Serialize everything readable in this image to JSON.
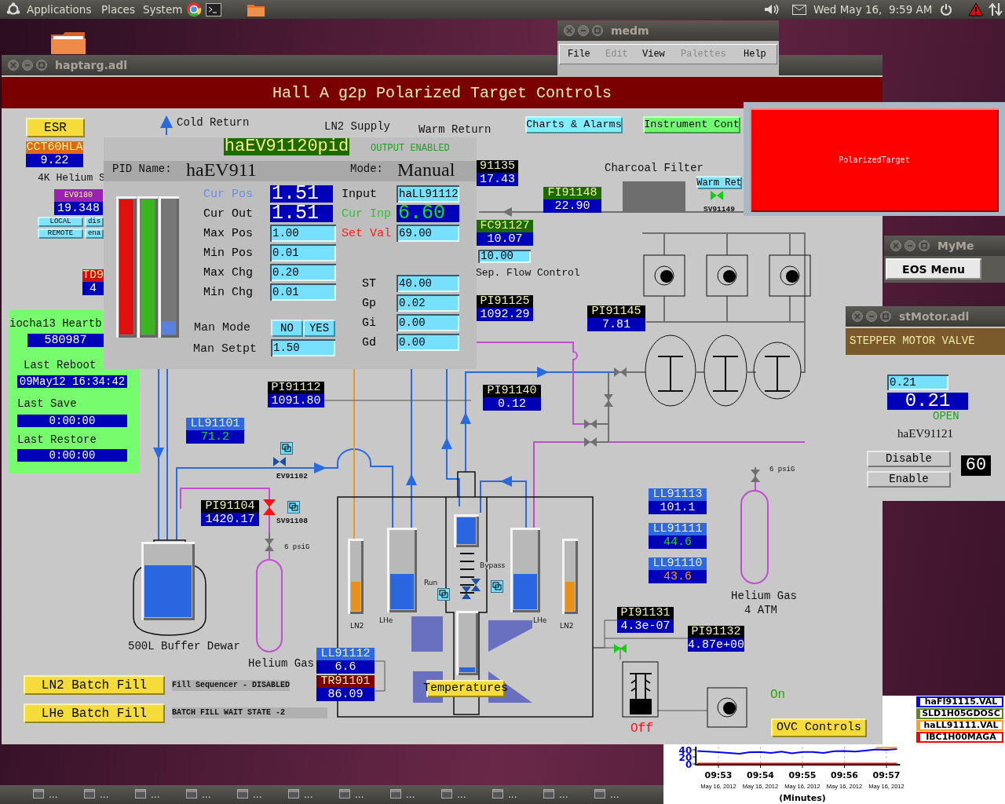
{
  "top_panel": {
    "menus": [
      "Applications",
      "Places",
      "System"
    ],
    "clock": "Wed May 16,  9:59 AM"
  },
  "taskbar": {
    "items": [
      "...",
      "...",
      "...",
      "...",
      "...",
      "...",
      "...",
      "...",
      "...",
      "...",
      "...",
      "..."
    ]
  },
  "chart_window": {
    "tick_dates": [
      "May 16, 2012",
      "May 16, 2012",
      "May 16, 2012",
      "May 16, 2012",
      "May 16, 2012"
    ],
    "chart_data": {
      "type": "line",
      "xlabel": "(Minutes)",
      "categories": [
        null,
        null,
        "09:53",
        null,
        null,
        null,
        "09:54",
        null,
        null,
        null,
        "09:55",
        null,
        null,
        null,
        "09:56",
        null,
        null,
        null,
        "09:57",
        null
      ],
      "ylim": [
        0,
        50
      ],
      "grid": true,
      "yticks": [
        0,
        20,
        40
      ],
      "series": [
        {
          "name": "haFI91115.VAL",
          "color": "#0000ff",
          "values": [
            37,
            35,
            33,
            31,
            29,
            33,
            34,
            31,
            35,
            30,
            34,
            34,
            31,
            36,
            37,
            35,
            38,
            41,
            40,
            42
          ]
        },
        {
          "name": "SLD1H05GDOSC",
          "color": "#5a8a20",
          "values": [
            null,
            null,
            null,
            null,
            null,
            null,
            null,
            null,
            null,
            null,
            null,
            null,
            null,
            null,
            null,
            null,
            null,
            null,
            null,
            null
          ]
        },
        {
          "name": "haLL91111.VAL",
          "color": "#ffa020",
          "values": [
            null,
            null,
            null,
            null,
            null,
            null,
            null,
            null,
            null,
            null,
            null,
            null,
            null,
            null,
            null,
            null,
            null,
            46,
            46,
            46
          ]
        },
        {
          "name": "IBC1H00MAGA",
          "color": "#ff0000",
          "values": [
            1,
            1,
            1,
            1,
            1,
            1,
            1,
            1,
            1,
            1,
            1,
            1,
            1,
            1,
            1,
            1,
            1,
            1,
            1,
            1
          ]
        }
      ]
    }
  },
  "haptarg": {
    "title": "haptarg.adl",
    "banner": "Hall A g2p Polarized Target Controls",
    "buttons": [
      {
        "label": "ESR",
        "color": "#f5dc3a"
      },
      {
        "label": "Charts & Alarms",
        "color": "#80f0ff"
      },
      {
        "label": "Instrument Cont",
        "color": "#70ff70"
      },
      {
        "label": "Warm Ret",
        "color": "#80e4ff"
      },
      {
        "label": "LOCAL",
        "color": "#80e4ff"
      },
      {
        "label": "dis",
        "color": "#80e4ff"
      },
      {
        "label": "REMOTE",
        "color": "#80e4ff"
      },
      {
        "label": "ena",
        "color": "#80e4ff"
      },
      {
        "label": "LN2 Batch Fill",
        "color": "#f5dc3a"
      },
      {
        "label": "LHe Batch Fill",
        "color": "#f5dc3a"
      },
      {
        "label": "Temperatures",
        "color": "#f5dc3a"
      },
      {
        "label": "OVC Controls",
        "color": "#f5dc3a"
      }
    ],
    "labels": [
      "4K Helium S",
      "Cold Return",
      "LN2 Supply",
      "Warm Return",
      "Charcoal Filter",
      "Sep. Flow Control",
      "500L Buffer Dewar",
      "Helium Gas",
      "Helium Gas",
      "4 ATM",
      "6 psiG",
      "6 psiG",
      "Run",
      "Bypass",
      "Fill Sequencer - DISABLED",
      "BATCH FILL WAIT STATE -2"
    ],
    "monitors": [
      {
        "name": "CCT60HLA",
        "value": "9.22",
        "color": "#e06a10"
      },
      {
        "name": "EV9180",
        "value": "19.348",
        "color": "#9a22b0"
      },
      {
        "name": "TD9",
        "value": "4",
        "color": "#d01010"
      },
      {
        "name": "91135",
        "value": "17.43",
        "color": "#000000"
      },
      {
        "name": "FI91148",
        "value": "22.90",
        "color": "#1c6a00"
      },
      {
        "name": "FC91127",
        "value": "10.07",
        "color": "#1c6a00"
      },
      {
        "name": "PI91125",
        "value": "1092.29",
        "color": "#000000"
      },
      {
        "name": "PI91145",
        "value": "7.81",
        "color": "#000000"
      },
      {
        "name": "PI91112",
        "value": "1091.80",
        "color": "#000000"
      },
      {
        "name": "PI91140",
        "value": "0.12",
        "color": "#000000"
      },
      {
        "name": "LL91101",
        "value": "71.2",
        "color": "#2f68e0",
        "alarm_sensitive": true,
        "minor_alarm": false
      },
      {
        "name": "PI91104",
        "value": "1420.17",
        "color": "#000000"
      },
      {
        "name": "LL91113",
        "value": "101.1",
        "color": "#2f68e0"
      },
      {
        "name": "LL91111",
        "value": "44.6",
        "color": "#2f68e0",
        "alarm_sensitive": true,
        "minor_alarm": false
      },
      {
        "name": "LL91110",
        "value": "43.6",
        "color": "#2f68e0",
        "alarm_sensitive": true,
        "minor_alarm": true
      },
      {
        "name": "PI91131",
        "value": "4.3e-07",
        "color": "#000000"
      },
      {
        "name": "PI91132",
        "value": "4.87e+00",
        "color": "#000000"
      },
      {
        "name": "LL91112",
        "value": "6.6",
        "color": "#2f68e0"
      },
      {
        "name": "TR91101",
        "value": "86.09",
        "color": "#7a0000"
      }
    ],
    "heartbeat": {
      "title": "iocha13 Heartb",
      "count": "580987",
      "rows": [
        {
          "label": "Last Reboot",
          "value": "09May12 16:34:42"
        },
        {
          "label": "Last Save",
          "value": "0:00:00"
        },
        {
          "label": "Last Restore",
          "value": "0:00:00"
        }
      ]
    },
    "flow_setpoint": "10.00",
    "valves": [
      {
        "label": "SV91149",
        "color": "#10d010"
      },
      {
        "label": "EV91102",
        "color": "#1f4f9a"
      },
      {
        "label": "SV91108",
        "color": "#ff1010"
      },
      {
        "color": "#10d010"
      }
    ],
    "dewar": {
      "level": 0.72
    },
    "gauges": [
      {
        "label": "LN2",
        "kind": "ln2",
        "level": 0.42
      },
      {
        "label": "LHe",
        "kind": "lhe",
        "level": 0.45
      },
      {
        "kind": "lhe",
        "level": 1
      },
      {
        "kind": "lhe",
        "level": 0.08
      },
      {
        "label": "LHe",
        "kind": "lhe",
        "level": 0.45
      },
      {
        "label": "LN2",
        "kind": "ln2",
        "level": 0.42
      }
    ],
    "pumps": [
      {
        "label": "Off",
        "on": false
      },
      {
        "label": "On",
        "on": true
      }
    ]
  },
  "medm": {
    "title": "medm",
    "menu": [
      {
        "label": "File",
        "disabled": false
      },
      {
        "label": "Edit",
        "disabled": true
      },
      {
        "label": "View",
        "disabled": false
      },
      {
        "label": "Palettes",
        "disabled": true
      },
      {
        "label": "Help",
        "disabled": false
      }
    ]
  },
  "pid": {
    "title": "haEV91120pid",
    "status": "OUTPUT ENABLED",
    "name_label": "PID Name:",
    "name": "haEV911",
    "mode_label": "Mode:",
    "mode": "Manual",
    "bars": [
      {
        "level": 1,
        "color": "#e01010"
      },
      {
        "level": 1,
        "color": "#3cb422"
      },
      {
        "level": 0.1,
        "color": "#5a80e0"
      }
    ],
    "left": [
      {
        "label": "Cur Pos",
        "value": "1.51",
        "kind": "readout",
        "color": "#6a8cf0"
      },
      {
        "label": "Cur Out",
        "value": "1.51",
        "kind": "readout",
        "color": "#000000"
      },
      {
        "label": "Max Pos",
        "value": "1.00",
        "kind": "entry",
        "color": "#000000"
      },
      {
        "label": "Min Pos",
        "value": "0.01",
        "kind": "entry",
        "color": "#000000"
      },
      {
        "label": "Max Chg",
        "value": "0.20",
        "kind": "entry",
        "color": "#000000"
      },
      {
        "label": "Min Chg",
        "value": "0.01",
        "kind": "entry",
        "color": "#000000"
      }
    ],
    "right": [
      {
        "label": "Input",
        "value": "haLL91112",
        "kind": "entry",
        "color": "#000000"
      },
      {
        "label": "Cur Inp",
        "value": "6.60",
        "kind": "readout",
        "color": "#30c030",
        "alarm_sensitive": true,
        "minor_alarm": false
      },
      {
        "label": "Set Val",
        "value": "69.00",
        "kind": "entry",
        "color": "#ff2020"
      },
      {
        "label": "ST",
        "value": "40.00",
        "kind": "entry",
        "color": "#000000"
      },
      {
        "label": "Gp",
        "value": "0.02",
        "kind": "entry",
        "color": "#000000"
      },
      {
        "label": "Gi",
        "value": "0.00",
        "kind": "entry",
        "color": "#000000"
      },
      {
        "label": "Gd",
        "value": "0.00",
        "kind": "entry",
        "color": "#000000"
      }
    ],
    "man_mode": {
      "label": "Man Mode",
      "options": [
        "NO",
        "YES"
      ]
    },
    "man_setpt": {
      "label": "Man Setpt",
      "value": "1.50"
    }
  },
  "polarized_target": {
    "label": "PolarizedTarget"
  },
  "mymenu": {
    "title": "MyMe",
    "button": "EOS Menu"
  },
  "stmotor": {
    "title": "stMotor.adl",
    "header": "STEPPER MOTOR VALVE",
    "setpoint": "0.21",
    "readout": "0.21",
    "status": "OPEN",
    "name": "haEV91121",
    "buttons": [
      "Disable",
      "Enable"
    ],
    "counter": "60"
  }
}
